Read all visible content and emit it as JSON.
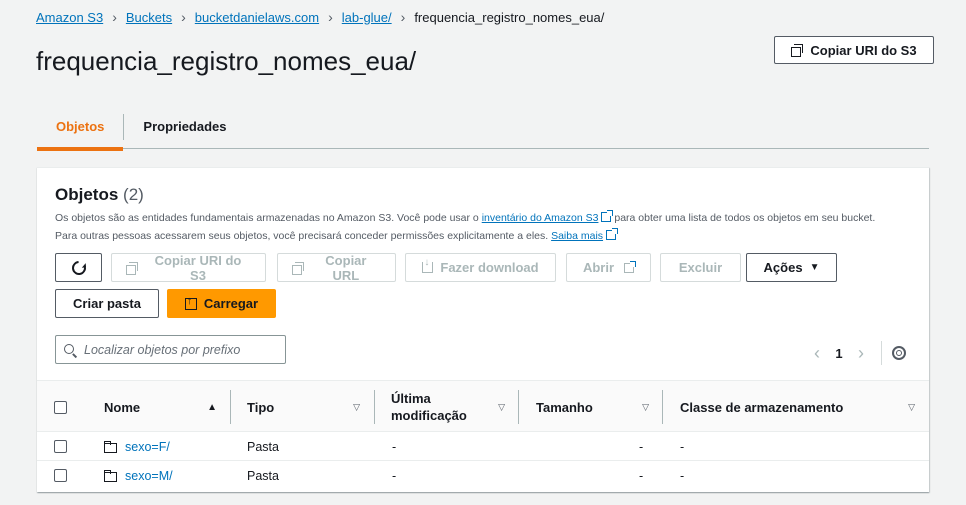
{
  "breadcrumb": [
    "Amazon S3",
    "Buckets",
    "bucketdanielaws.com",
    "lab-glue/",
    "frequencia_registro_nomes_eua/"
  ],
  "page_title": "frequencia_registro_nomes_eua/",
  "header_actions": {
    "copy_uri": "Copiar URI do S3"
  },
  "tabs": [
    {
      "label": "Objetos",
      "active": true
    },
    {
      "label": "Propriedades",
      "active": false
    }
  ],
  "objects_panel": {
    "title": "Objetos",
    "count": "(2)",
    "desc_part1": "Os objetos são as entidades fundamentais armazenadas no Amazon S3. Você pode usar o ",
    "desc_link1": "inventário do Amazon S3",
    "desc_part2": " para obter uma lista de todos os objetos em seu bucket.",
    "desc_part3": "Para outras pessoas acessarem seus objetos, você precisará conceder permissões explicitamente a eles. ",
    "desc_link2": "Saiba mais"
  },
  "toolbar": {
    "copy_uri": "Copiar URI do S3",
    "copy_url": "Copiar URL",
    "download": "Fazer download",
    "open": "Abrir",
    "delete": "Excluir",
    "actions": "Ações",
    "create_folder": "Criar pasta",
    "upload": "Carregar"
  },
  "search": {
    "placeholder": "Localizar objetos por prefixo"
  },
  "pagination": {
    "page": "1"
  },
  "table": {
    "columns": {
      "name": "Nome",
      "type": "Tipo",
      "modified_line1": "Última",
      "modified_line2": "modificação",
      "size": "Tamanho",
      "storage_class": "Classe de armazenamento"
    },
    "rows": [
      {
        "name": "sexo=F/",
        "type": "Pasta",
        "modified": "-",
        "size": "-",
        "storage_class": "-"
      },
      {
        "name": "sexo=M/",
        "type": "Pasta",
        "modified": "-",
        "size": "-",
        "storage_class": "-"
      }
    ]
  },
  "colors": {
    "link": "#0073bb",
    "accent": "#ec7211",
    "primary_button": "#ff9900",
    "background": "#f2f3f3"
  }
}
